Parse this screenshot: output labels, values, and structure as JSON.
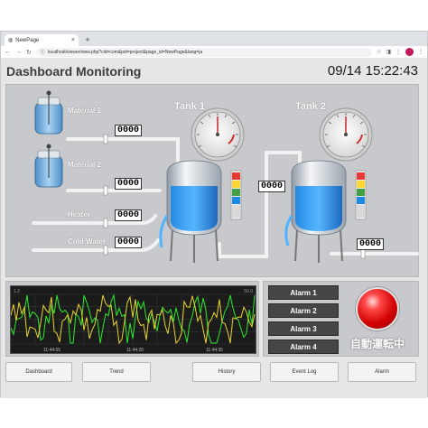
{
  "browser": {
    "tab_title": "NewPage",
    "tab_close": "×",
    "new_tab": "+",
    "url": "localhost/viewer/view.php?cid=com&pid=project&page_id=NewPage&lang=ja"
  },
  "header": {
    "title": "Dashboard Monitoring",
    "datetime": "09/14 15:22:43"
  },
  "plant": {
    "material1": {
      "label": "Material 1",
      "value": "0000"
    },
    "material2": {
      "label": "Material 2",
      "value": "0000"
    },
    "heater": {
      "label": "Heater",
      "value": "0000"
    },
    "cold_water": {
      "label": "Cold Water",
      "value": "0000"
    },
    "tank1": {
      "label": "Tank 1"
    },
    "tank2": {
      "label": "Tank 2"
    },
    "transfer_value": "0000",
    "outlet_value": "0000"
  },
  "trend": {
    "header_left": "1.2",
    "header_right": "50.0",
    "time_labels": [
      "11:44:05",
      "11:44:20",
      "11:44:35"
    ],
    "series_colors": [
      "#2ee82e",
      "#e8d52e"
    ]
  },
  "alarms": {
    "items": [
      "Alarm 1",
      "Alarm 2",
      "Alarm 3",
      "Alarm 4"
    ],
    "status_label": "自動運転中",
    "lamp_color": "#ff2b2b"
  },
  "nav": {
    "dashboard": "Dashboard",
    "trend": "Trend",
    "history": "History",
    "event_log": "Event Log",
    "alarm": "Alarm"
  }
}
